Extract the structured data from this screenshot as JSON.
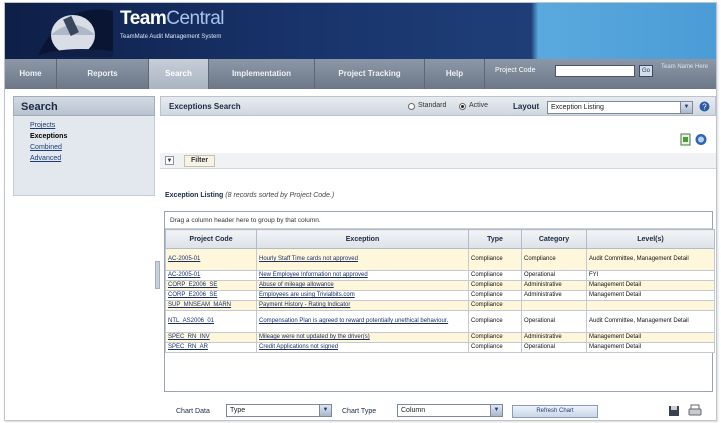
{
  "app": {
    "title_a": "Team",
    "title_b": "Central",
    "subtitle": "TeamMate Audit Management System"
  },
  "nav": {
    "items": [
      "Home",
      "Reports",
      "Search",
      "Implementation",
      "Project Tracking",
      "Help"
    ],
    "active": "Search",
    "project_code_label": "Project Code",
    "go_label": "Go",
    "right_text": "Team Name Here"
  },
  "sidebar": {
    "title": "Search",
    "items": [
      "Projects",
      "Exceptions",
      "Combined",
      "Advanced"
    ],
    "selected": "Exceptions"
  },
  "main": {
    "title": "Exceptions Search",
    "radio_standard": "Standard",
    "radio_active": "Active",
    "active_mode": "Active",
    "layout_label": "Layout",
    "layout_value": "Exception Listing",
    "filter_label": "Filter",
    "listing_title": "Exception Listing",
    "listing_note": "(8 records sorted by Project Code.)",
    "group_hint": "Drag a column header here to group by that column.",
    "columns": [
      "Project Code",
      "Exception",
      "Type",
      "Category",
      "Level(s)"
    ],
    "rows": [
      [
        "AC-2005-01",
        "Hourly Staff Time cards not approved",
        "Compliance",
        "Compliance",
        "Audit Committee, Management Detail"
      ],
      [
        "AC-2005-01",
        "New Employee Information not approved",
        "Compliance",
        "Operational",
        "FYI"
      ],
      [
        "CORP_E2006_SE",
        "Abuse of mileage allowance",
        "Compliance",
        "Administrative",
        "Management Detail"
      ],
      [
        "CORP_E2006_SE",
        "Employees are using Trivialbits.com",
        "Compliance",
        "Administrative",
        "Management Detail"
      ],
      [
        "SUP_MNSEAM_MARN",
        "Payment History - Rating Indicator",
        "Compliance",
        "",
        ""
      ],
      [
        "NTL_AS2006_01",
        "Compensation Plan is agreed to reward potentially unethical behaviour.",
        "Compliance",
        "Operational",
        "Audit Committee, Management Detail"
      ],
      [
        "SPEC_RN_INV",
        "Mileage were not updated by the driver(s)",
        "Compliance",
        "Administrative",
        "Management Detail"
      ],
      [
        "SPEC_RN_AR",
        "Credit Applications not signed",
        "Compliance",
        "Operational",
        "Management Detail"
      ]
    ],
    "chart_data_label": "Chart Data",
    "chart_data_value": "Type",
    "chart_type_label": "Chart Type",
    "chart_type_value": "Column",
    "refresh_label": "Refresh Chart"
  }
}
